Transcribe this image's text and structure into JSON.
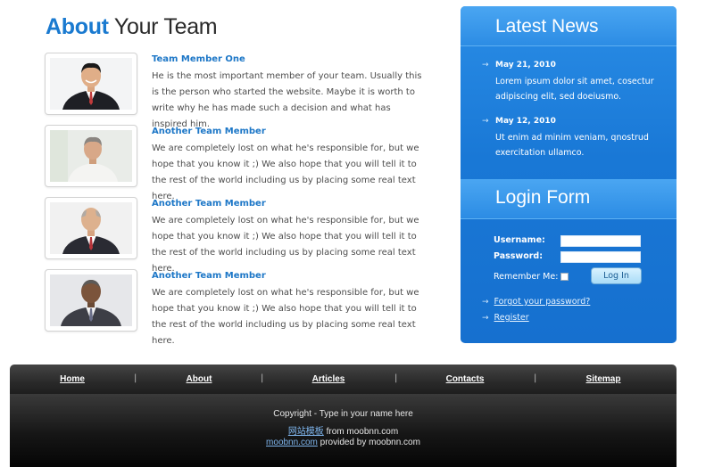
{
  "page": {
    "title_accent": "About",
    "title_rest": " Your Team"
  },
  "team": [
    {
      "name": "Team Member One",
      "bio": "He is the most important member of your team. Usually this is the person who started the website. Maybe it is worth to write why he has made such a decision and what has inspired him."
    },
    {
      "name": "Another Team Member",
      "bio": "We are completely lost on what he's responsible for, but we hope that you know it ;) We also hope that you will tell it to the rest of the world including us by placing some real text here."
    },
    {
      "name": "Another Team Member",
      "bio": "We are completely lost on what he's responsible for, but we hope that you know it ;) We also hope that you will tell it to the rest of the world including us by placing some real text here."
    },
    {
      "name": "Another Team Member",
      "bio": "We are completely lost on what he's responsible for, but we hope that you know it ;) We also hope that you will tell it to the rest of the world including us by placing some real text here."
    }
  ],
  "news": {
    "title": "Latest News",
    "items": [
      {
        "date": "May 21, 2010",
        "text": "Lorem ipsum dolor sit amet, cosectur adipiscing elit, sed doeiusmo."
      },
      {
        "date": "May 12, 2010",
        "text": "Ut enim ad minim veniam, qnostrud exercitation ullamco."
      }
    ]
  },
  "login": {
    "title": "Login Form",
    "username_label": "Username:",
    "password_label": "Password:",
    "remember_label": "Remember Me:",
    "button_label": "Log In",
    "forgot_label": "Forgot your password?",
    "register_label": "Register"
  },
  "footer": {
    "nav": [
      "Home",
      "About",
      "Articles",
      "Contacts",
      "Sitemap"
    ],
    "separator": "|",
    "copyright": "Copyright - Type in your name here",
    "line2_link": "网站模板",
    "line2_text": " from moobnn.com",
    "line3_link": "moobnn.com",
    "line3_text": " provided by moobnn.com"
  },
  "colors": {
    "accent": "#1a7ad0",
    "sidebar_blue": "#1978d6",
    "footer_dark": "#1e1e1e"
  }
}
